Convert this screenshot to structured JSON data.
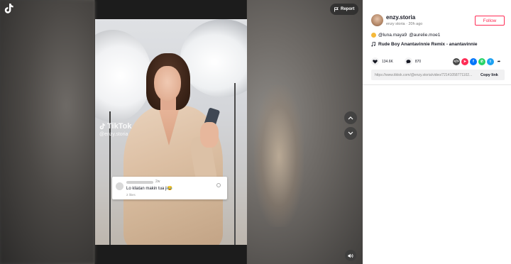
{
  "video": {
    "report_label": "Report",
    "watermark_brand": "TikTok",
    "watermark_handle": "@enzy.storia",
    "comment": {
      "time": "2w",
      "text": "Lo kliatan makin tua ji😂",
      "likes": "2 likes"
    }
  },
  "author": {
    "username": "enzy.storia",
    "subline": "enzy storia · 20h ago",
    "follow_label": "Follow"
  },
  "caption": {
    "mention_1": "@luna.maya9",
    "mention_2": "@aurelie.moe1"
  },
  "music": {
    "title": "Rude Boy Anantavinnie Remix - anantavinnie"
  },
  "stats": {
    "likes": "134.6K",
    "comments": "870"
  },
  "share": {
    "link": "https://www.tiktok.com/@enzy.storia/video/72141058771102...",
    "copy_label": "Copy link"
  },
  "colors": {
    "brand_red": "#fe2c55",
    "text_primary": "#161823"
  }
}
